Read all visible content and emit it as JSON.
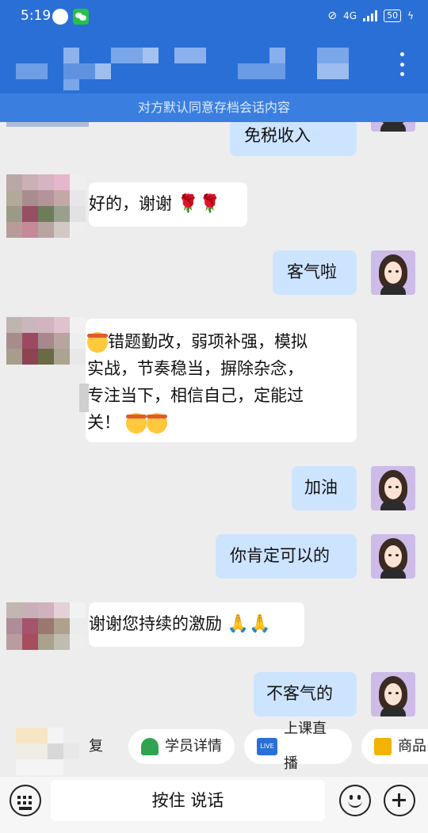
{
  "status": {
    "time": "5:19",
    "network": "4G",
    "battery": "50"
  },
  "notice": "对方默认同意存档会话内容",
  "messages": [
    {
      "from": "me",
      "text": "免税收入"
    },
    {
      "from": "them",
      "text": "好的，谢谢"
    },
    {
      "from": "me",
      "text": "客气啦"
    },
    {
      "from": "them",
      "line1": "错题勤改，弱项补强，模拟",
      "line2": "实战，节奏稳当，摒除杂念，",
      "line3": "专注当下，相信自己，定能过",
      "line4": "关！"
    },
    {
      "from": "me",
      "text": "加油"
    },
    {
      "from": "me",
      "text": "你肯定可以的"
    },
    {
      "from": "them",
      "text": "谢谢您持续的激励"
    },
    {
      "from": "me",
      "text": "不客气的"
    }
  ],
  "quick_actions": [
    {
      "label": "复",
      "icon": "reply-icon"
    },
    {
      "label": "学员详情",
      "icon": "student-detail-icon"
    },
    {
      "label": "上课直播",
      "icon": "live-icon"
    },
    {
      "label": "商品",
      "icon": "product-icon"
    }
  ],
  "live_badge": "LIVE",
  "input": {
    "hold_to_talk": "按住 说话"
  },
  "colors": {
    "primary": "#2a6fd6",
    "my_bubble": "#cde4ff",
    "their_bubble": "#ffffff"
  }
}
